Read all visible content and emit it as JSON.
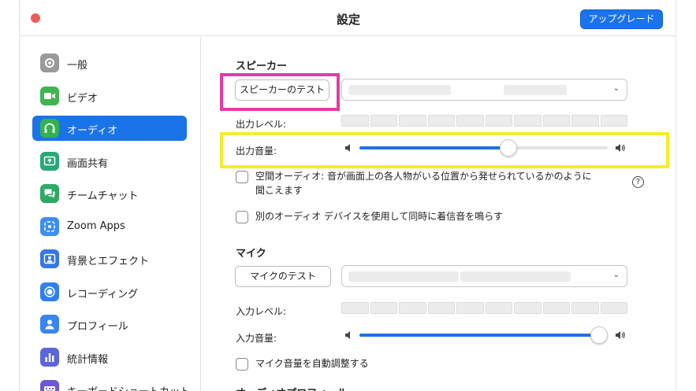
{
  "window": {
    "title": "設定",
    "upgrade_label": "アップグレード"
  },
  "sidebar": {
    "items": [
      {
        "label": "一般",
        "icon": "gear-icon",
        "color": "#9a9a9a"
      },
      {
        "label": "ビデオ",
        "icon": "video-camera-icon",
        "color": "#3fb450"
      },
      {
        "label": "オーディオ",
        "icon": "headphones-icon",
        "color": "#33b24f",
        "active": true
      },
      {
        "label": "画面共有",
        "icon": "share-screen-icon",
        "color": "#29a877"
      },
      {
        "label": "チームチャット",
        "icon": "chat-bubble-icon",
        "color": "#2ea964"
      },
      {
        "label": "Zoom Apps",
        "icon": "apps-icon",
        "color": "#3c8ef0"
      },
      {
        "label": "背景とエフェクト",
        "icon": "background-person-icon",
        "color": "#3578e5"
      },
      {
        "label": "レコーディング",
        "icon": "record-icon",
        "color": "#2f80ed"
      },
      {
        "label": "プロフィール",
        "icon": "profile-icon",
        "color": "#3a86ef"
      },
      {
        "label": "統計情報",
        "icon": "statistics-icon",
        "color": "#5b67d8"
      },
      {
        "label": "キーボードショートカット",
        "icon": "keyboard-icon",
        "color": "#6b5bd2"
      }
    ]
  },
  "speaker": {
    "section_title": "スピーカー",
    "test_button": "スピーカーのテスト",
    "output_level_label": "出力レベル:",
    "output_volume_label": "出力音量:",
    "volume_level": 0.6
  },
  "options": {
    "spatial_audio_line1": "空間オーディオ: 音が画面上の各人物がいる位置から発せられているかのように",
    "spatial_audio_line2": "聞こえます",
    "help_icon_glyph": "?",
    "ring_separate_device": "別のオーディオ デバイスを使用して同時に着信音を鳴らす"
  },
  "mic": {
    "section_title": "マイク",
    "test_button": "マイクのテスト",
    "input_level_label": "入力レベル:",
    "input_volume_label": "入力音量:",
    "volume_level": 0.97,
    "auto_adjust_label": "マイク音量を自動調整する"
  },
  "audio_profile": {
    "section_title": "オーディオプロフィール"
  },
  "colors": {
    "accent": "#1a73e8",
    "highlight_pink": "#e43ca4",
    "highlight_yellow": "#f4ee2a"
  }
}
